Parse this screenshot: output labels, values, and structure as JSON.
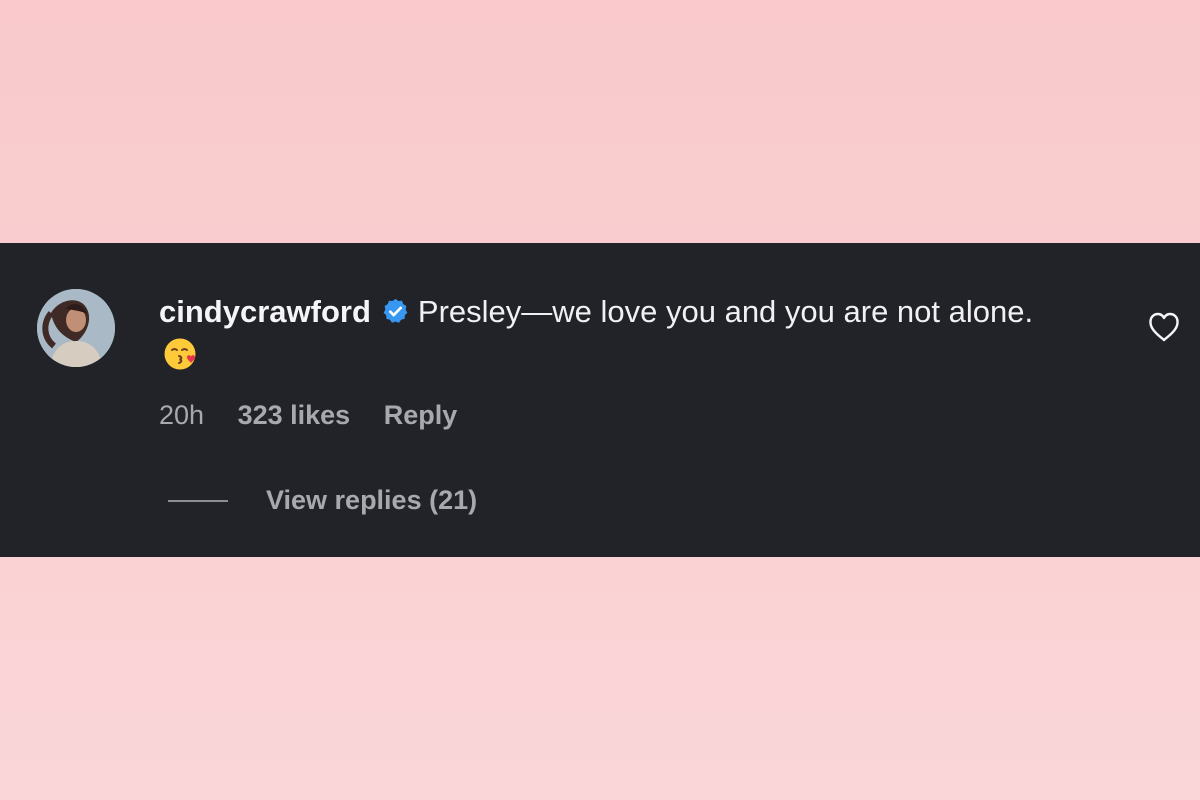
{
  "comment": {
    "username": "cindycrawford",
    "text": "Presley—we love you and you are not alone.",
    "emoji": "kissing-face-with-heart",
    "timestamp": "20h",
    "likes": "323 likes",
    "reply_label": "Reply",
    "view_replies": "View replies (21)"
  },
  "colors": {
    "panel_background": "#212328",
    "page_background": "#f9c9cb",
    "verified_badge": "#3897f0",
    "secondary_text": "#a7a9ae"
  },
  "icons": {
    "verified": "verified-badge-icon",
    "like": "heart-outline-icon",
    "avatar": "profile-avatar"
  }
}
